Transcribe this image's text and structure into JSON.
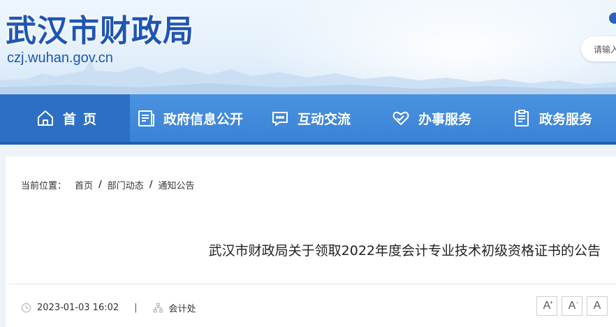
{
  "header": {
    "site_title": "武汉市财政局",
    "site_domain": "czjwuhan.gov.cn",
    "search_placeholder": "请输入"
  },
  "nav": {
    "items": [
      {
        "label": "首页",
        "icon": "home-icon",
        "active": true
      },
      {
        "label": "政府信息公开",
        "icon": "document-icon"
      },
      {
        "label": "互动交流",
        "icon": "chat-icon"
      },
      {
        "label": "办事服务",
        "icon": "heart-hand-icon"
      },
      {
        "label": "政务服务",
        "icon": "clipboard-icon"
      }
    ]
  },
  "breadcrumb": {
    "prefix": "当前位置：",
    "items": [
      "首页",
      "部门动态",
      "通知公告"
    ]
  },
  "article": {
    "title": "武汉市财政局关于领取2022年度会计专业技术初级资格证书的公告",
    "datetime": "2023-01-03 16:02",
    "source": "会计处"
  },
  "font_size_controls": [
    {
      "label": "A",
      "mark": "+"
    },
    {
      "label": "A",
      "mark": "-"
    },
    {
      "label": "A",
      "mark": ""
    }
  ],
  "colors": {
    "brand_blue": "#1f56b3",
    "nav_blue": "#3a82d6",
    "nav_active": "#2d6fc4"
  }
}
